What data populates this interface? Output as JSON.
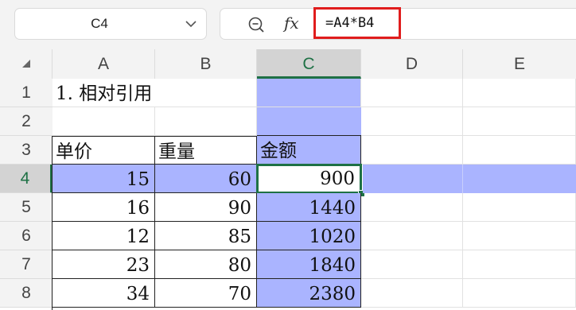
{
  "name_box": {
    "value": "C4"
  },
  "formula_bar": {
    "zoom_icon": "zoom-icon",
    "fx_label": "fx",
    "formula": "=A4*B4"
  },
  "columns": [
    "A",
    "B",
    "C",
    "D",
    "E"
  ],
  "rows": [
    "1",
    "2",
    "3",
    "4",
    "5",
    "6",
    "7",
    "8"
  ],
  "selection": {
    "column": "C",
    "row": "4"
  },
  "highlight_color": "#aab4ff",
  "active_border_color": "#1e7145",
  "cells": {
    "A1": "1. 相对引用",
    "A3": "单价",
    "B3": "重量",
    "C3": "金额",
    "A4": "15",
    "B4": "60",
    "C4": "900",
    "A5": "16",
    "B5": "90",
    "C5": "1440",
    "A6": "12",
    "B6": "85",
    "C6": "1020",
    "A7": "23",
    "B7": "80",
    "C7": "1840",
    "A8": "34",
    "B8": "70",
    "C8": "2380"
  }
}
